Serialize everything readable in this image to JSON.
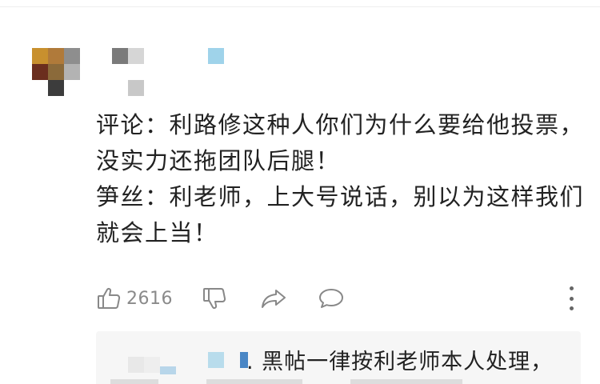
{
  "comment": {
    "lines": [
      "评论：利路修这种人你们为什么要给他投票，",
      "没实力还拖团队后腿！",
      "笋丝：利老师，上大号说话，别以为这样我们",
      "就会上当！"
    ]
  },
  "actions": {
    "like_icon": "thumbs-up-icon",
    "like_count": "2616",
    "dislike_icon": "thumbs-down-icon",
    "share_icon": "share-icon",
    "reply_icon": "comment-bubble-icon",
    "more_icon": "more-vertical-icon"
  },
  "reply": {
    "text": ". 黑帖一律按利老师本人处理，"
  },
  "colors": {
    "text": "#222222",
    "icon": "#888888",
    "reply_bg": "#f6f6f6"
  }
}
